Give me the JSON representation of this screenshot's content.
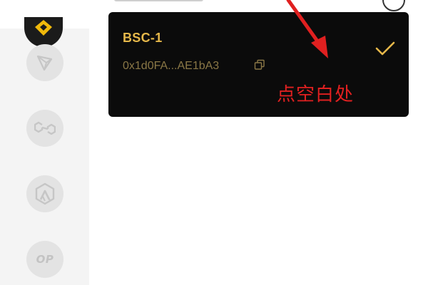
{
  "wallet": {
    "name": "BSC-1",
    "address": "0x1d0FA...AE1bA3",
    "selected": true
  },
  "annotation": {
    "text": "点空白处",
    "color": "#e02020"
  },
  "chains": [
    {
      "icon": "bnb-chain-icon",
      "active": true
    },
    {
      "icon": "tron-icon",
      "active": false
    },
    {
      "icon": "polygon-icon",
      "active": false
    },
    {
      "icon": "arbitrum-icon",
      "active": false
    },
    {
      "icon": "optimism-icon",
      "label": "OP",
      "active": false
    }
  ],
  "colors": {
    "card_background": "#0b0b0b",
    "accent_gold": "#e6b84a",
    "sidebar_background": "#f4f4f4"
  }
}
